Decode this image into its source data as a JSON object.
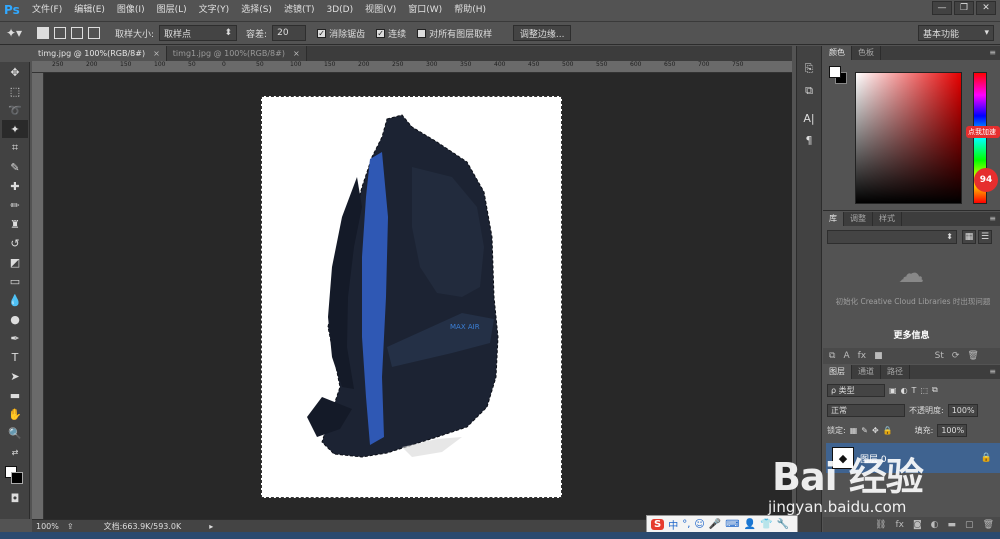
{
  "app": {
    "logo": "Ps"
  },
  "menu": [
    "文件(F)",
    "编辑(E)",
    "图像(I)",
    "图层(L)",
    "文字(Y)",
    "选择(S)",
    "滤镜(T)",
    "3D(D)",
    "视图(V)",
    "窗口(W)",
    "帮助(H)"
  ],
  "window_controls": [
    "—",
    "❐",
    "✕"
  ],
  "options": {
    "sample_size_label": "取样大小:",
    "sample_size_value": "取样点",
    "tolerance_label": "容差:",
    "tolerance_value": "20",
    "antialias_label": "消除锯齿",
    "contiguous_label": "连续",
    "all_layers_label": "对所有图层取样",
    "refine_edge_label": "调整边缘...",
    "workspace_value": "基本功能"
  },
  "tabs": [
    {
      "label": "timg.jpg @ 100%(RGB/8#)",
      "active": true
    },
    {
      "label": "timg1.jpg @ 100%(RGB/8#)",
      "active": false
    }
  ],
  "ruler_ticks": [
    "250",
    "200",
    "150",
    "100",
    "50",
    "0",
    "50",
    "100",
    "150",
    "200",
    "250",
    "300",
    "350",
    "400",
    "450",
    "500",
    "550",
    "600",
    "650",
    "700",
    "750"
  ],
  "status": {
    "zoom": "100%",
    "doc_info": "文档:663.9K/593.0K"
  },
  "color_panel": {
    "tabs": [
      "颜色",
      "色板"
    ]
  },
  "library_panel": {
    "tabs": [
      "库",
      "调整",
      "样式"
    ],
    "message": "初始化 Creative Cloud Libraries 时出现问题",
    "more_info": "更多信息"
  },
  "layers_panel": {
    "tabs": [
      "图层",
      "通道",
      "路径"
    ],
    "filter_label": "ρ 类型",
    "blend_mode": "正常",
    "opacity_label": "不透明度:",
    "opacity_value": "100%",
    "lock_label": "锁定:",
    "fill_label": "填充:",
    "fill_value": "100%",
    "layer_name": "图层 0"
  },
  "promo": {
    "label": "点我加速",
    "value": "94"
  },
  "ime": {
    "logo": "S",
    "mode": "中"
  },
  "watermark": {
    "text": "Bai 经验",
    "url": "jingyan.baidu.com"
  },
  "colors": {
    "accent": "#31a8ff",
    "selection": "#3f6390",
    "canvas": "#282828"
  }
}
